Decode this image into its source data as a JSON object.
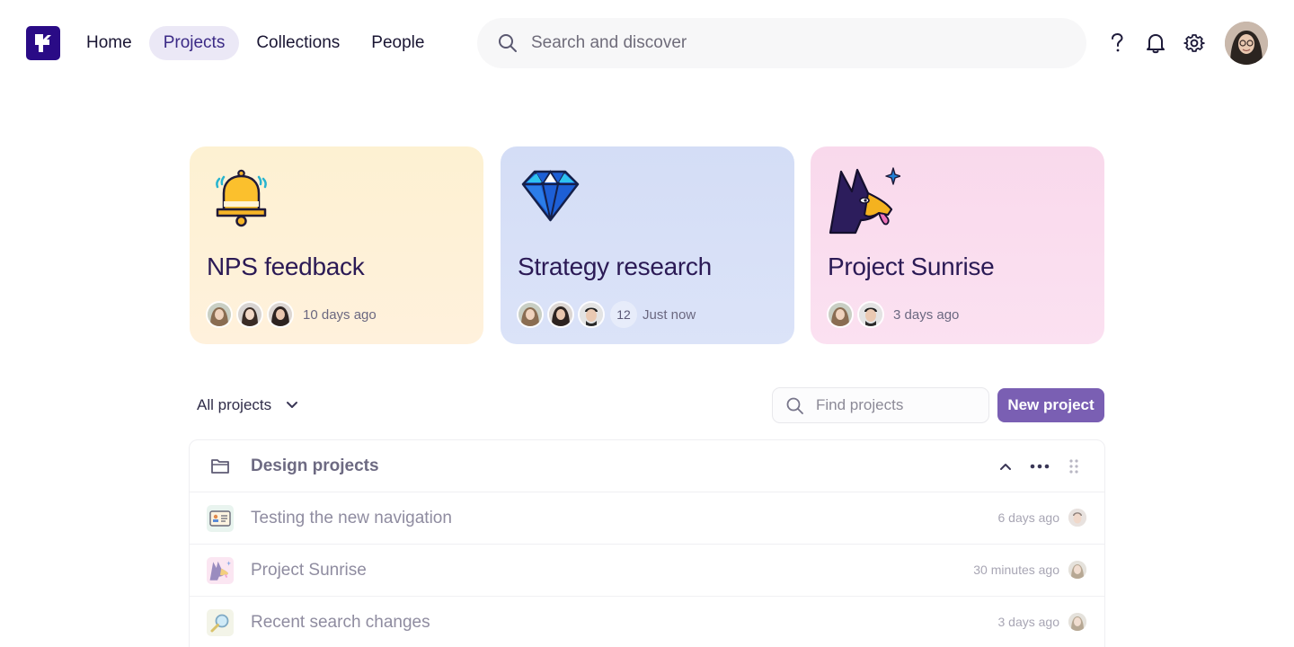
{
  "nav": {
    "items": [
      {
        "label": "Home",
        "active": false
      },
      {
        "label": "Projects",
        "active": true
      },
      {
        "label": "Collections",
        "active": false
      },
      {
        "label": "People",
        "active": false
      }
    ]
  },
  "search": {
    "placeholder": "Search and discover",
    "value": ""
  },
  "header_icons": [
    "help-icon",
    "bell-icon",
    "gear-icon"
  ],
  "feature_cards": [
    {
      "title": "NPS feedback",
      "icon": "bell-icon",
      "avatars": 3,
      "member_count": null,
      "time": "10 days ago",
      "color": "#fdf1d2"
    },
    {
      "title": "Strategy research",
      "icon": "diamond-icon",
      "avatars": 3,
      "member_count": "12",
      "time": "Just now",
      "color": "#d4ddf6"
    },
    {
      "title": "Project Sunrise",
      "icon": "dog-icon",
      "avatars": 2,
      "member_count": null,
      "time": "3 days ago",
      "color": "#f9d9ec"
    }
  ],
  "toolbar": {
    "filter_label": "All projects",
    "find_placeholder": "Find projects",
    "new_project_label": "New project",
    "accent": "#7a5fb3"
  },
  "group": {
    "title": "Design projects",
    "rows": [
      {
        "title": "Testing the new navigation",
        "time": "6 days ago",
        "icon": "id-card-icon"
      },
      {
        "title": "Project Sunrise",
        "time": "30 minutes ago",
        "icon": "dog-icon"
      },
      {
        "title": "Recent search changes",
        "time": "3 days ago",
        "icon": "magnifier-icon"
      }
    ]
  }
}
